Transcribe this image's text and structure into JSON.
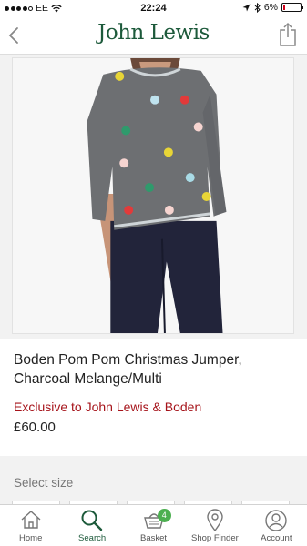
{
  "status_bar": {
    "carrier": "EE",
    "time": "22:24",
    "battery": "6%",
    "battery_level": 0.06,
    "battery_color": "#d0021b"
  },
  "header": {
    "logo_text": "John Lewis",
    "brand_color": "#1d5a3b"
  },
  "product": {
    "title": "Boden Pom Pom Christmas Jumper, Charcoal Melange/Multi",
    "exclusive_text": "Exclusive to John Lewis & Boden",
    "exclusive_color": "#a6141b",
    "price": "£60.00"
  },
  "size_section": {
    "label": "Select size"
  },
  "tab_bar": {
    "active_color": "#1d5a3b",
    "tabs": [
      {
        "label": "Home",
        "icon": "home-icon"
      },
      {
        "label": "Search",
        "icon": "search-icon",
        "active": true
      },
      {
        "label": "Basket",
        "icon": "basket-icon",
        "badge": "4"
      },
      {
        "label": "Shop Finder",
        "icon": "location-pin-icon"
      },
      {
        "label": "Account",
        "icon": "account-icon"
      }
    ]
  }
}
